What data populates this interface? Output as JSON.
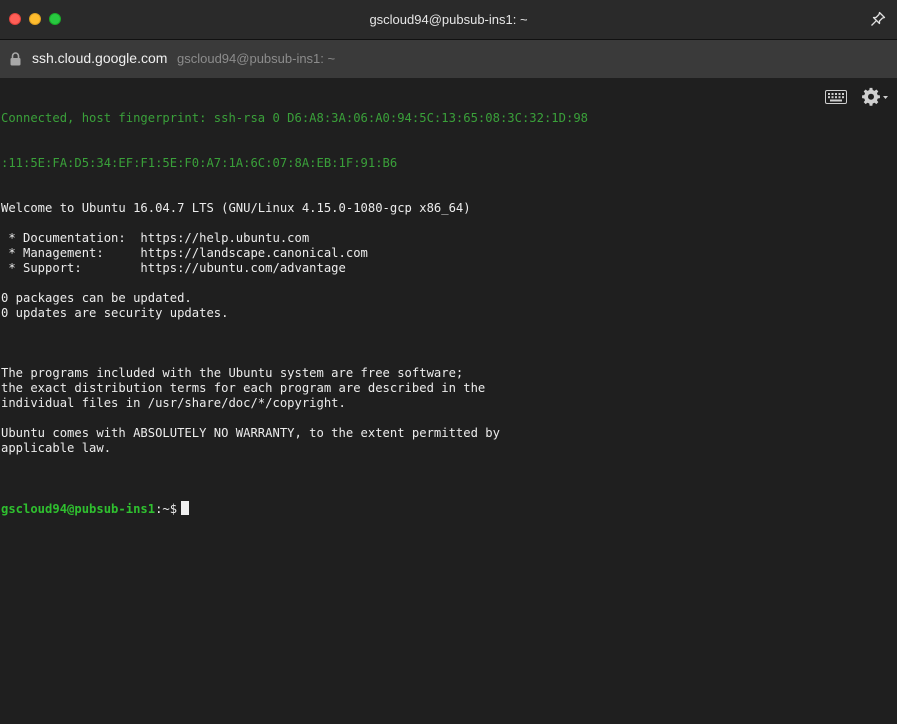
{
  "window": {
    "title": "gscloud94@pubsub-ins1: ~"
  },
  "address": {
    "domain": "ssh.cloud.google.com",
    "path": "gscloud94@pubsub-ins1: ~"
  },
  "terminal": {
    "fingerprint_line1": "Connected, host fingerprint: ssh-rsa 0 D6:A8:3A:06:A0:94:5C:13:65:08:3C:32:1D:98",
    "fingerprint_line2": ":11:5E:FA:D5:34:EF:F1:5E:F0:A7:1A:6C:07:8A:EB:1F:91:B6",
    "lines": [
      "Welcome to Ubuntu 16.04.7 LTS (GNU/Linux 4.15.0-1080-gcp x86_64)",
      "",
      " * Documentation:  https://help.ubuntu.com",
      " * Management:     https://landscape.canonical.com",
      " * Support:        https://ubuntu.com/advantage",
      "",
      "0 packages can be updated.",
      "0 updates are security updates.",
      "",
      "",
      "",
      "The programs included with the Ubuntu system are free software;",
      "the exact distribution terms for each program are described in the",
      "individual files in /usr/share/doc/*/copyright.",
      "",
      "Ubuntu comes with ABSOLUTELY NO WARRANTY, to the extent permitted by",
      "applicable law.",
      ""
    ],
    "prompt_user": "gscloud94@pubsub-ins1",
    "prompt_path": ":~$"
  },
  "icons": {
    "pin": "pin-icon",
    "lock": "lock-icon",
    "keyboard": "keyboard-icon",
    "settings": "gear-icon"
  },
  "colors": {
    "close": "#ff5f57",
    "minimize": "#febc2e",
    "maximize": "#28c840",
    "prompt_green": "#2fc02f",
    "fingerprint_green": "#3aa03a"
  }
}
